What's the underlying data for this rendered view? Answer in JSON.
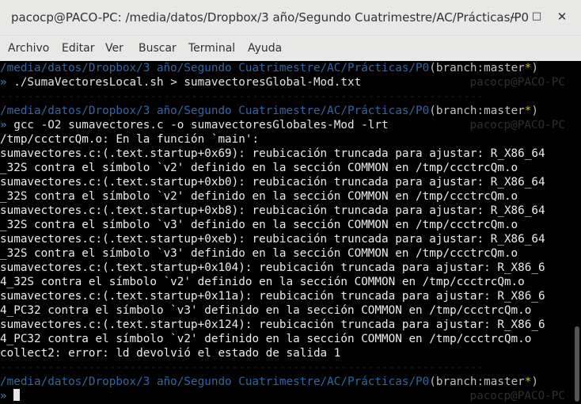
{
  "window": {
    "title": "pacocp@PACO-PC: /media/datos/Dropbox/3 año/Segundo Cuatrimestre/AC/Prácticas/P0",
    "minimize_glyph": "–",
    "maximize_glyph": "□",
    "close_glyph": "✕"
  },
  "menu": [
    "Archivo",
    "Editar",
    "Ver",
    "Buscar",
    "Terminal",
    "Ayuda"
  ],
  "terminal": {
    "cwd": "/media/datos/Dropbox/3 año/Segundo Cuatrimestre/AC/Prácticas/P0",
    "branch_label": "branch:master",
    "branch_dirty_mark": "*",
    "prompt_symbol": "»",
    "host_hint": "pacocp@PACO-PC",
    "separator": "-----------------------------------------------------------------------",
    "commands": [
      "./SumaVectoresLocal.sh > sumavectoresGlobal-Mod.txt",
      "gcc -O2 sumavectores.c -o sumavectoresGlobales-Mod -lrt"
    ],
    "output": [
      "/tmp/ccctrcQm.o: En la función `main':",
      "sumavectores.c:(.text.startup+0x69): reubicación truncada para ajustar: R_X86_64",
      "_32S contra el símbolo `v2' definido en la sección COMMON en /tmp/ccctrcQm.o",
      "sumavectores.c:(.text.startup+0xb0): reubicación truncada para ajustar: R_X86_64",
      "_32S contra el símbolo `v2' definido en la sección COMMON en /tmp/ccctrcQm.o",
      "sumavectores.c:(.text.startup+0xb8): reubicación truncada para ajustar: R_X86_64",
      "_32S contra el símbolo `v3' definido en la sección COMMON en /tmp/ccctrcQm.o",
      "sumavectores.c:(.text.startup+0xeb): reubicación truncada para ajustar: R_X86_64",
      "_32S contra el símbolo `v3' definido en la sección COMMON en /tmp/ccctrcQm.o",
      "sumavectores.c:(.text.startup+0x104): reubicación truncada para ajustar: R_X86_6",
      "4_32S contra el símbolo `v2' definido en la sección COMMON en /tmp/ccctrcQm.o",
      "sumavectores.c:(.text.startup+0x11a): reubicación truncada para ajustar: R_X86_6",
      "4_PC32 contra el símbolo `v3' definido en la sección COMMON en /tmp/ccctrcQm.o",
      "sumavectores.c:(.text.startup+0x124): reubicación truncada para ajustar: R_X86_6",
      "4_PC32 contra el símbolo `v2' definido en la sección COMMON en /tmp/ccctrcQm.o",
      "collect2: error: ld devolvió el estado de salida 1"
    ]
  },
  "colors": {
    "path": "#3465a4",
    "prompt": "#4c7dc2",
    "dirty_mark": "#d4c400",
    "background": "#000000"
  }
}
